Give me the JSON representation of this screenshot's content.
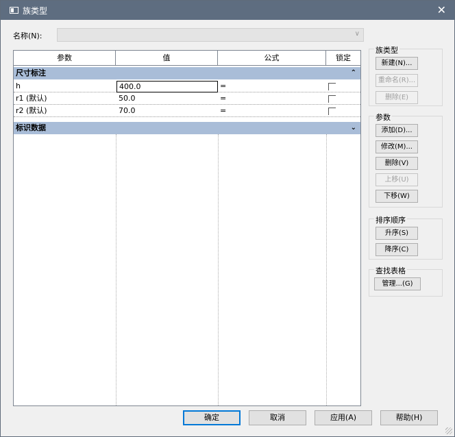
{
  "window": {
    "title": "族类型",
    "close_glyph": "✕"
  },
  "name_field": {
    "label": "名称(N):",
    "value": "",
    "caret": "∨"
  },
  "grid": {
    "headers": [
      "参数",
      "值",
      "公式",
      "锁定"
    ],
    "groups": [
      {
        "label": "尺寸标注",
        "toggle": "⌃",
        "rows": [
          {
            "param": "h",
            "value": "400.0",
            "formula": "="
          },
          {
            "param": "r1 (默认)",
            "value": "50.0",
            "formula": "="
          },
          {
            "param": "r2 (默认)",
            "value": "70.0",
            "formula": "="
          }
        ]
      },
      {
        "label": "标识数据",
        "toggle": "⌄",
        "rows": []
      }
    ]
  },
  "side": {
    "family_types": {
      "caption": "族类型",
      "new": "新建(N)...",
      "rename": "重命名(R)...",
      "delete": "删除(E)"
    },
    "parameters": {
      "caption": "参数",
      "add": "添加(D)...",
      "modify": "修改(M)...",
      "delete": "删除(V)",
      "move_up": "上移(U)",
      "move_down": "下移(W)"
    },
    "sort": {
      "caption": "排序顺序",
      "ascending": "升序(S)",
      "descending": "降序(C)"
    },
    "lookup": {
      "caption": "查找表格",
      "manage": "管理...(G)"
    }
  },
  "footer": {
    "ok": "确定",
    "cancel": "取消",
    "apply": "应用(A)",
    "help": "帮助(H)"
  }
}
